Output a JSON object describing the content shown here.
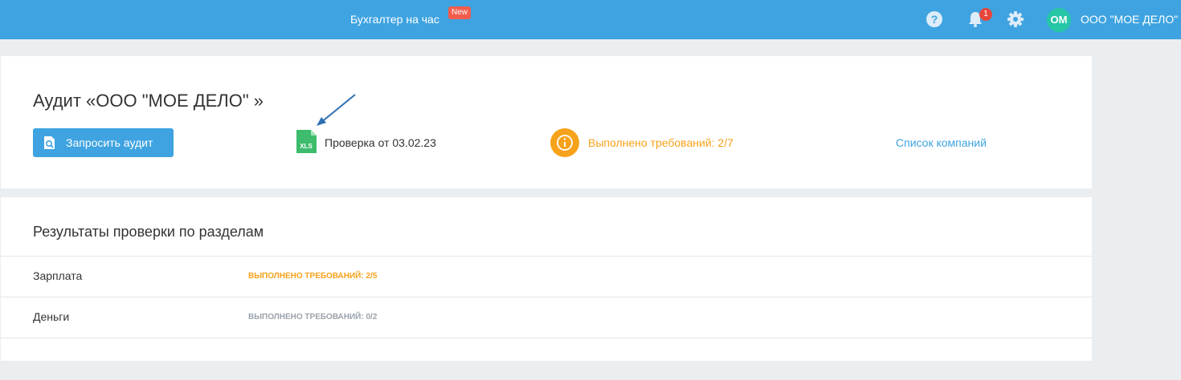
{
  "header": {
    "nav_link": "Бухгалтер на час",
    "new_badge": "New",
    "bell_count": "1",
    "avatar_initials": "ОМ",
    "company_name": "ООО \"МОЕ ДЕЛО\"",
    "icons": [
      "help-icon",
      "bell-icon",
      "gear-icon"
    ]
  },
  "audit": {
    "title": "Аудит «ООО \"МОЕ ДЕЛО\" »",
    "request_button": "Запросить аудит",
    "file_icon_text": "XLS",
    "check_label": "Проверка от 03.02.23",
    "requirements_done": "Выполнено требований: 2/7",
    "companies_link": "Список компаний"
  },
  "results": {
    "title": "Результаты проверки по разделам",
    "rows": [
      {
        "name": "Зарплата",
        "status": "ВЫПОЛНЕНО ТРЕБОВАНИЙ: 2/5"
      },
      {
        "name": "Деньги",
        "status": "ВЫПОЛНЕНО ТРЕБОВАНИЙ: 0/2"
      }
    ]
  },
  "colors": {
    "topbar": "#3ea3e0",
    "accent_orange": "#f7a21b",
    "badge_red": "#f25c4d",
    "xls_green": "#3cbc6c",
    "avatar": "#26c6a6"
  }
}
